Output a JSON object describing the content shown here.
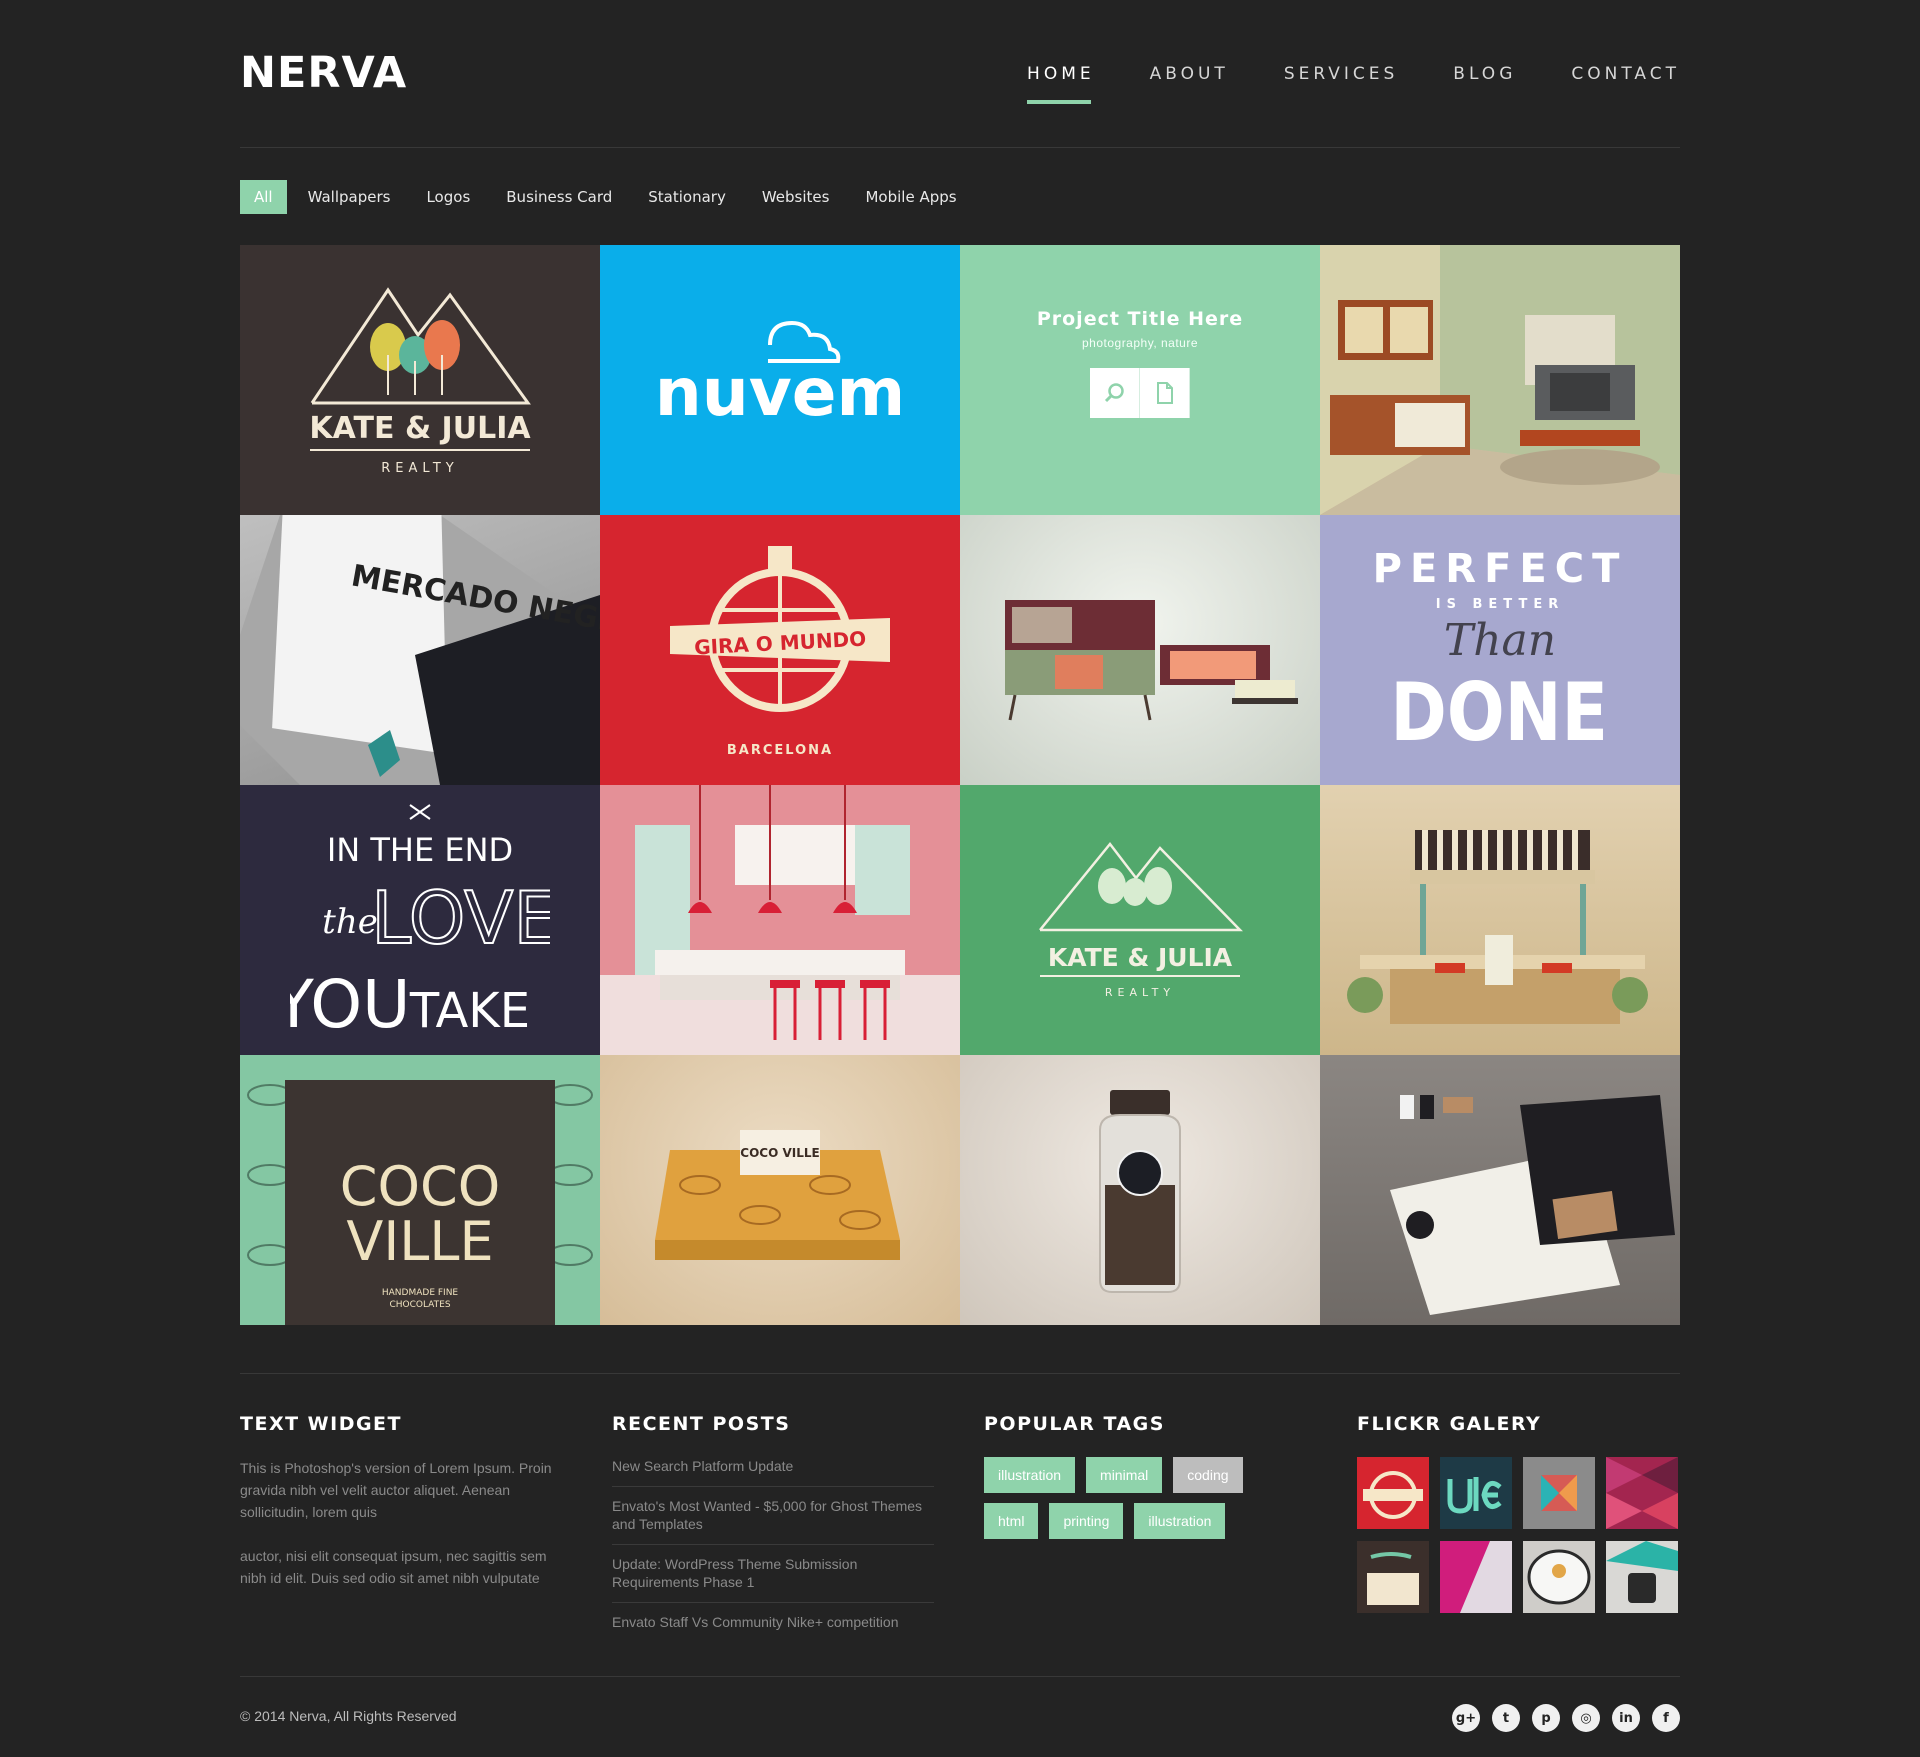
{
  "brand": {
    "logo": "NERVA",
    "accent": "#8fd3ab"
  },
  "nav": {
    "items": [
      "HOME",
      "ABOUT",
      "SERVICES",
      "BLOG",
      "CONTACT"
    ],
    "active": "HOME"
  },
  "filters": {
    "items": [
      "All",
      "Wallpapers",
      "Logos",
      "Business Card",
      "Stationary",
      "Websites",
      "Mobile Apps"
    ],
    "active": "All"
  },
  "portfolio": {
    "tile1": {
      "brand": "KATE & JULIA",
      "sub": "REALTY"
    },
    "tile2": {
      "brand": "nuvem"
    },
    "tile3": {
      "title": "Project Title Here",
      "tags": "photography, nature",
      "icons": [
        "search-icon",
        "document-icon"
      ]
    },
    "tile5": {
      "brand": "MERCADO NEGRO"
    },
    "tile6": {
      "brand": "GIRA O MUNDO",
      "sub": "BARCELONA"
    },
    "tile8": {
      "line1": "PERFECT",
      "line2": "IS BETTER",
      "line3": "Than",
      "line4": "DONE"
    },
    "tile9": {
      "line1": "IN THE END",
      "line2": "the",
      "line3": "LOVE",
      "line4": "YOU",
      "line5": "TAKE"
    },
    "tile11": {
      "brand": "KATE & JULIA",
      "sub": "REALTY"
    },
    "tile13": {
      "brand1": "COCO",
      "brand2": "VILLE",
      "sub1": "HANDMADE FINE",
      "sub2": "CHOCOLATES"
    },
    "tile14": {
      "brand": "COCO VILLE"
    }
  },
  "widgets": {
    "text": {
      "title": "TEXT WIDGET",
      "p1": "This is Photoshop's version  of Lorem Ipsum. Proin gravida nibh vel velit auctor aliquet. Aenean sollicitudin, lorem quis",
      "p2": "auctor, nisi elit consequat ipsum, nec sagittis sem nibh id elit. Duis sed odio sit amet nibh vulputate"
    },
    "recent": {
      "title": "RECENT POSTS",
      "posts": [
        "New Search Platform Update",
        "Envato's Most Wanted - $5,000 for Ghost Themes and Templates",
        "Update: WordPress Theme Submission Requirements Phase 1",
        "Envato Staff Vs Community Nike+ competition"
      ]
    },
    "tags": {
      "title": "POPULAR TAGS",
      "items": [
        "illustration",
        "minimal",
        "coding",
        "html",
        "printing",
        "illustration"
      ]
    },
    "flickr": {
      "title": "FLICKR GALERY"
    }
  },
  "footer": {
    "copyright": "© 2014 Nerva,  All Rights Reserved",
    "social": [
      "google-plus-icon",
      "twitter-icon",
      "pinterest-icon",
      "dribbble-icon",
      "linkedin-icon",
      "facebook-icon"
    ]
  }
}
